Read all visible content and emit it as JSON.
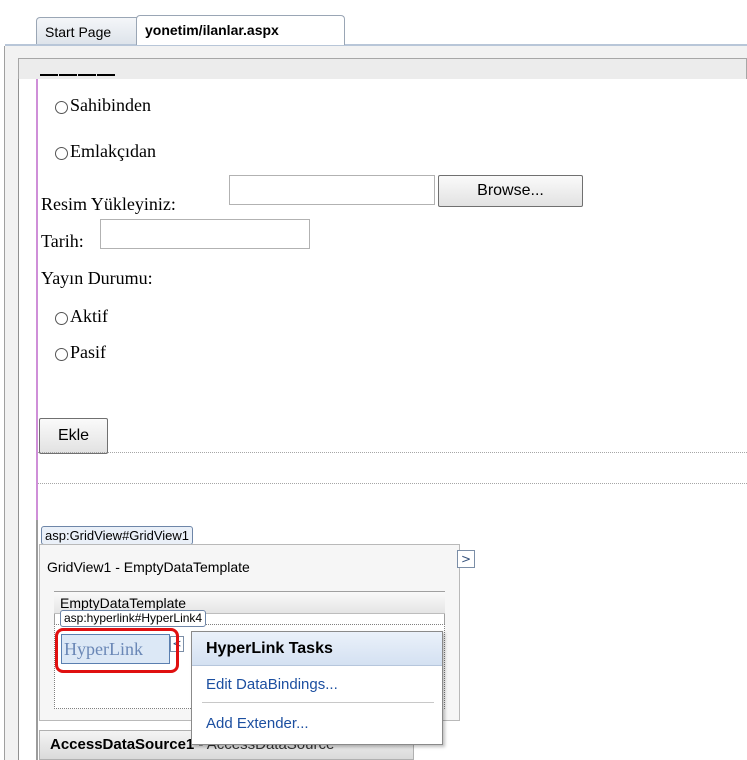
{
  "tabs": {
    "start_page": "Start Page",
    "active_file": "yonetim/ilanlar.aspx"
  },
  "form": {
    "radio_sahibinden": "Sahibinden",
    "radio_emlakcidan": "Emlakçıdan",
    "resim_label": "Resim Yükleyiniz:",
    "browse_button": "Browse...",
    "tarih_label": "Tarih:",
    "yayin_label": "Yayın Durumu:",
    "radio_aktif": "Aktif",
    "radio_pasif": "Pasif",
    "ekle_button": "Ekle"
  },
  "gridview": {
    "tag": "asp:GridView#GridView1",
    "header": "GridView1 - EmptyDataTemplate",
    "chevron": ">",
    "template_title": "EmptyDataTemplate",
    "hyperlink_tag": "asp:hyperlink#HyperLink4",
    "hyperlink_text": "HyperLink",
    "hyperlink_chevron": "<"
  },
  "tasks_menu": {
    "title": "HyperLink Tasks",
    "items": [
      "Edit DataBindings...",
      "Add Extender..."
    ]
  },
  "bottom": {
    "control_name": "AccessDataSource1",
    "control_rest": " - AccessDataSource"
  },
  "colors": {
    "highlight": "#e01010",
    "link": "#1c4fa0"
  }
}
